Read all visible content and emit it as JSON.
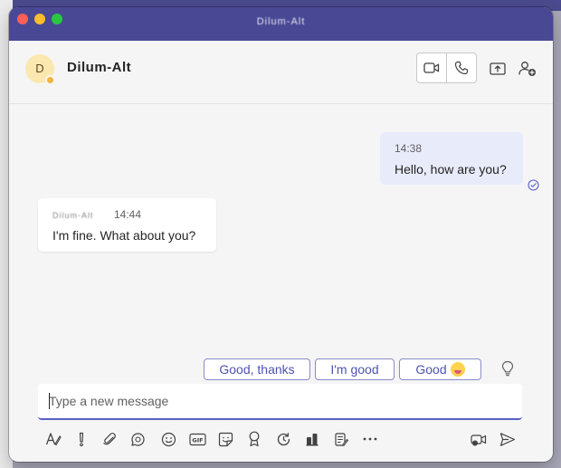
{
  "window": {
    "title": "Dilum-Alt"
  },
  "chat_header": {
    "avatar_initial": "D",
    "contact_name": "Dilum-Alt"
  },
  "messages": [
    {
      "direction": "outgoing",
      "time": "14:38",
      "text": "Hello, how are you?"
    },
    {
      "direction": "incoming",
      "sender": "Dilum-Alt",
      "time": "14:44",
      "text": "I'm fine. What about you?"
    }
  ],
  "suggested_replies": [
    {
      "label": "Good, thanks"
    },
    {
      "label": "I'm good"
    },
    {
      "label": "Good"
    }
  ],
  "compose": {
    "placeholder": "Type a new message",
    "value": ""
  },
  "icons": {
    "video_call": "video-camera-icon",
    "audio_call": "phone-icon",
    "share_screen": "share-screen-icon",
    "add_people": "add-people-icon",
    "read_receipt": "check-circle-icon",
    "suggestion_tips": "lightbulb-icon",
    "format": "format-icon",
    "important": "exclamation-icon",
    "attach": "paperclip-icon",
    "loop": "loop-icon",
    "emoji": "emoji-icon",
    "gif": "gif-icon",
    "sticker": "sticker-icon",
    "praise": "praise-icon",
    "schedule": "schedule-icon",
    "apps": "apps-icon",
    "forms": "forms-icon",
    "more": "more-icon",
    "meet_now": "meet-now-icon",
    "send": "send-icon"
  },
  "colors": {
    "titlebar": "#494895",
    "accent": "#5b5fc7",
    "outgoing_bubble": "#e8ebfa",
    "incoming_bubble": "#ffffff",
    "presence_away": "#f4b33c"
  }
}
